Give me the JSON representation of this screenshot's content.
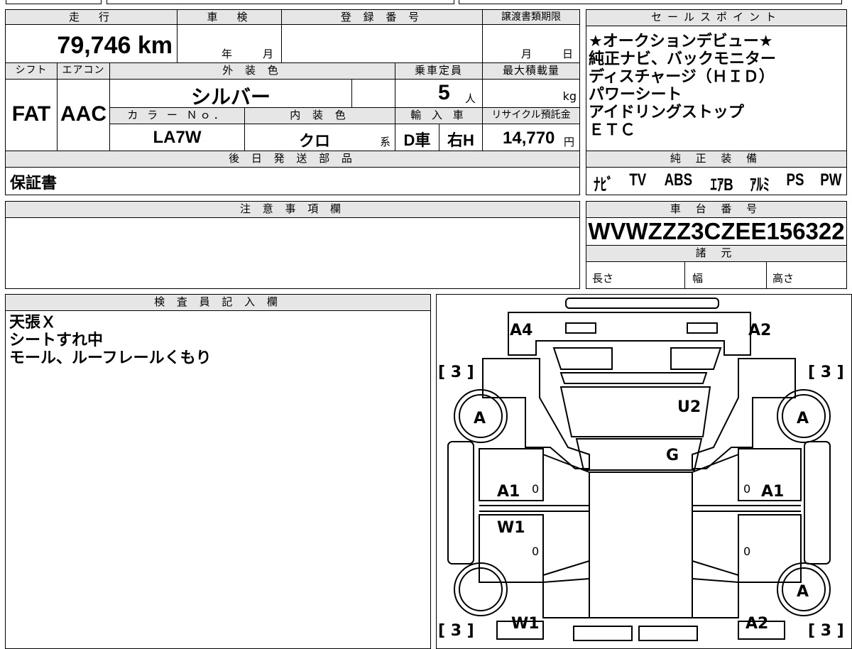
{
  "summary": {
    "headers": {
      "mileage": "走　行",
      "shaken": "車　検",
      "reg_no": "登 録 番 号",
      "transfer_deadline": "譲渡書類期限",
      "shift": "シフト",
      "aircon": "エアコン",
      "exterior_color": "外 装 色",
      "capacity": "乗車定員",
      "max_load": "最大積載量",
      "color_no": "カ ラ ー Ｎｏ．",
      "interior_color": "内 装 色",
      "import": "輸 入 車",
      "recycle": "リサイクル預託金"
    },
    "mileage": "79,746 km",
    "shaken_year_unit": "年",
    "shaken_month_unit": "月",
    "transfer_month_unit": "月",
    "transfer_day_unit": "日",
    "shift": "FAT",
    "aircon": "AAC",
    "exterior_color": "シルバー",
    "capacity": "5",
    "capacity_unit": "人",
    "max_load_unit": "kg",
    "color_no": "LA7W",
    "interior_color": "クロ",
    "interior_suffix": "系",
    "import_type": "D車",
    "steering": "右H",
    "recycle_fee": "14,770",
    "recycle_unit": "円",
    "later_parts_header": "後 日 発 送 部 品",
    "later_parts": "保証書"
  },
  "sales": {
    "header": "セールスポイント",
    "lines": [
      "★オークションデビュー★",
      "純正ナビ、バックモニター",
      "ディスチャージ（ＨＩＤ）",
      "パワーシート",
      "アイドリングストップ",
      "ＥＴＣ"
    ]
  },
  "equipment": {
    "header": "純 正 装 備",
    "items": [
      "ﾅﾋﾞ",
      "TV",
      "ABS",
      "ｴｱB",
      "ｱﾙﾐ",
      "PS",
      "PW"
    ]
  },
  "caution": {
    "header": "注 意 事 項 欄"
  },
  "chassis": {
    "header": "車 台 番 号",
    "number": "WVWZZZ3CZEE156322",
    "spec_header": "諸 元",
    "length_label": "長さ",
    "width_label": "幅",
    "height_label": "高さ"
  },
  "inspector": {
    "header": "検 査 員 記 入 欄",
    "notes": [
      "天張Ｘ",
      "シートすれ中",
      "モール、ルーフレールくもり"
    ]
  },
  "diagram": {
    "labels": {
      "a4": "A4",
      "a2_top": "A2",
      "u2": "U2",
      "g": "G",
      "a1_left": "A1",
      "a1_right": "A1",
      "w1_left": "W1",
      "w1_bottom": "W1",
      "a2_bottom": "A2",
      "wheel_tl": "A",
      "wheel_tr": "A",
      "wheel_br": "A",
      "tire_tl": "[ 3 ]",
      "tire_tr": "[ 3 ]",
      "tire_bl": "[ 3 ]",
      "tire_br": "[ 3 ]",
      "pillar_l1": "0",
      "pillar_r1": "0",
      "pillar_l2": "0",
      "pillar_r2": "0"
    }
  }
}
